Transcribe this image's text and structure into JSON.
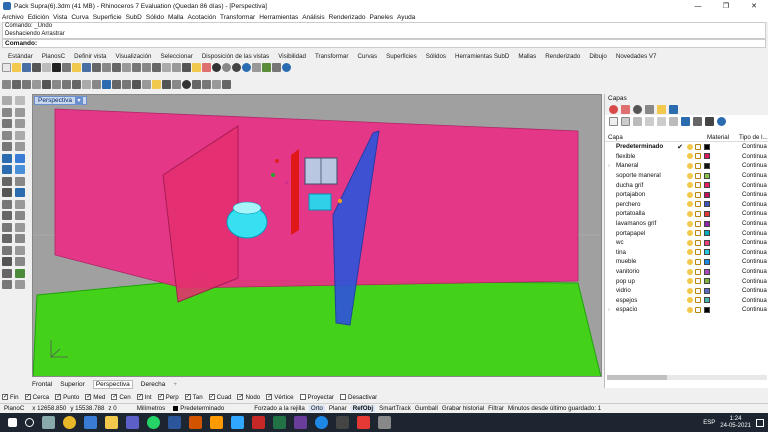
{
  "window": {
    "title": "Pack Supra(6).3dm (41 MB) - Rhinoceros 7 Evaluation (Quedan 86 días) - [Perspectiva]",
    "minimize": "—",
    "maximize": "❐",
    "close": "✕"
  },
  "menu": [
    "Archivo",
    "Edición",
    "Vista",
    "Curva",
    "Superficie",
    "SubD",
    "Sólido",
    "Malla",
    "Acotación",
    "Transformar",
    "Herramientas",
    "Análisis",
    "Renderizado",
    "Paneles",
    "Ayuda"
  ],
  "command": {
    "history": [
      "Comando: _Undo",
      "Deshaciendo Arrastrar"
    ],
    "prompt": "Comando:"
  },
  "toolbar_tabs": [
    "Estándar",
    "PlanosC",
    "Definir vista",
    "Visualización",
    "Seleccionar",
    "Disposición de las vistas",
    "Visibilidad",
    "Transformar",
    "Curvas",
    "Superficies",
    "Sólidos",
    "Herramientas SubD",
    "Mallas",
    "Renderizado",
    "Dibujo",
    "Novedades V7"
  ],
  "viewport": {
    "label": "Perspectiva",
    "tabs": [
      "Frontal",
      "Superior",
      "Perspectiva",
      "Derecha"
    ],
    "add_tab": "+"
  },
  "osnaps": [
    {
      "label": "Fin",
      "checked": true
    },
    {
      "label": "Cerca",
      "checked": true
    },
    {
      "label": "Punto",
      "checked": true
    },
    {
      "label": "Med",
      "checked": true
    },
    {
      "label": "Cen",
      "checked": true
    },
    {
      "label": "Int",
      "checked": true
    },
    {
      "label": "Perp",
      "checked": true
    },
    {
      "label": "Tan",
      "checked": true
    },
    {
      "label": "Cuad",
      "checked": true
    },
    {
      "label": "Nodo",
      "checked": true
    },
    {
      "label": "Vértice",
      "checked": true
    },
    {
      "label": "Proyectar",
      "checked": false
    },
    {
      "label": "Desactivar",
      "checked": false
    }
  ],
  "status": {
    "cplane": "PlanoC",
    "x": "x 12658.850",
    "y": "y 15538.788",
    "z": "z 0",
    "units": "Milímetros",
    "layer": "Predeterminado",
    "grid_snap": "Forzado a la rejilla",
    "ortho": "Orto",
    "planar": "Planar",
    "osnap": "RefObj",
    "smarttrack": "SmartTrack",
    "gumball": "Gumball",
    "history": "Grabar historial",
    "filter": "Filtrar",
    "autosave": "Minutos desde último guardado: 1"
  },
  "layers_panel": {
    "title": "Capas",
    "columns": {
      "name": "Capa",
      "material": "Material",
      "linetype": "Tipo de l..."
    },
    "layers": [
      {
        "name": "Predeterminado",
        "current": true,
        "expand": "",
        "color": "#000000",
        "linetype": "Continua"
      },
      {
        "name": "flexible",
        "current": false,
        "expand": "",
        "color": "#d81b60",
        "linetype": "Continua"
      },
      {
        "name": "Maneral",
        "current": false,
        "expand": "›",
        "color": "#111111",
        "linetype": "Continua"
      },
      {
        "name": "soporte maneral",
        "current": false,
        "expand": "",
        "color": "#8bc34a",
        "linetype": "Continua"
      },
      {
        "name": "ducha grif",
        "current": false,
        "expand": "",
        "color": "#e91e63",
        "linetype": "Continua"
      },
      {
        "name": "portajabon",
        "current": false,
        "expand": "",
        "color": "#c51162",
        "linetype": "Continua"
      },
      {
        "name": "perchero",
        "current": false,
        "expand": "",
        "color": "#3f51b5",
        "linetype": "Continua"
      },
      {
        "name": "portatoalla",
        "current": false,
        "expand": "",
        "color": "#e53935",
        "linetype": "Continua"
      },
      {
        "name": "lavamanos grif",
        "current": false,
        "expand": "",
        "color": "#8e24aa",
        "linetype": "Continua"
      },
      {
        "name": "portapapel",
        "current": false,
        "expand": "",
        "color": "#00acc1",
        "linetype": "Continua"
      },
      {
        "name": "wc",
        "current": false,
        "expand": "",
        "color": "#ec407a",
        "linetype": "Continua"
      },
      {
        "name": "tina",
        "current": false,
        "expand": "",
        "color": "#26c6da",
        "linetype": "Continua"
      },
      {
        "name": "mueble",
        "current": false,
        "expand": "",
        "color": "#1e88e5",
        "linetype": "Continua"
      },
      {
        "name": "vanitorio",
        "current": false,
        "expand": "",
        "color": "#ab47bc",
        "linetype": "Continua"
      },
      {
        "name": "pop up",
        "current": false,
        "expand": "",
        "color": "#7cb342",
        "linetype": "Continua"
      },
      {
        "name": "vidrio",
        "current": false,
        "expand": "",
        "color": "#5c6bc0",
        "linetype": "Continua"
      },
      {
        "name": "espejos",
        "current": false,
        "expand": "",
        "color": "#4db6ac",
        "linetype": "Continua"
      },
      {
        "name": "espacio",
        "current": false,
        "expand": "›",
        "color": "#000000",
        "linetype": "Continua"
      }
    ]
  },
  "tray": {
    "lang": "ESP",
    "time": "1:24",
    "date": "24-05-2021"
  }
}
